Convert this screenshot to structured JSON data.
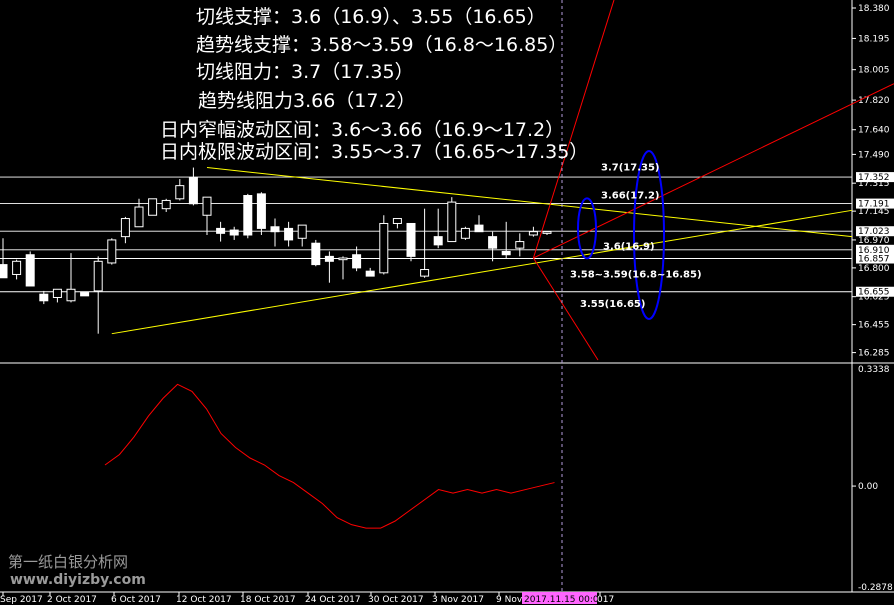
{
  "annotations": [
    "切线支撑：3.6（16.9）、3.55（16.65）",
    "趋势线支撑：3.58～3.59（16.8～16.85）",
    "切线阻力：3.7（17.35）",
    "趋势线阻力3.66（17.2）",
    "日内窄幅波动区间：3.6～3.66（16.9～17.2）",
    "日内极限波动区间：3.55～3.7（16.65～17.35）"
  ],
  "watermark": {
    "line1": "第一纸白银分析网",
    "line2": "www.diyizby.com"
  },
  "chart_data": {
    "type": "candlestick",
    "colors": {
      "background": "#000000",
      "axis": "#ffffff",
      "candle": "#ffffff",
      "macd_signal": "#ff0000",
      "trendline": "#ffff00",
      "resistance_fan": "#ff0000",
      "ellipse": "#0000ff",
      "cursor": "#b39ddb",
      "cursor_label_bg": "#ff66ff"
    },
    "price_axis": {
      "range": [
        16.24,
        18.38
      ],
      "ticks": [
        "18.380",
        "18.195",
        "18.005",
        "17.820",
        "17.640",
        "17.490",
        "17.315",
        "17.145",
        "16.970",
        "16.800",
        "16.625",
        "16.455",
        "16.285"
      ],
      "highlighted": [
        "17.352",
        "17.191",
        "17.023",
        "16.910",
        "16.857",
        "16.655"
      ]
    },
    "indicator_axis": {
      "range": [
        -0.2878,
        0.3338
      ],
      "ticks": [
        "0.3338",
        "0.00",
        "-0.2878"
      ]
    },
    "time_labels": [
      "Sep 2017",
      "2 Oct 2017",
      "6 Oct 2017",
      "12 Oct 2017",
      "18 Oct 2017",
      "24 Oct 2017",
      "30 Oct 2017",
      "3 Nov 2017",
      "9 Nov",
      "2017.11.15 00:00",
      "017"
    ],
    "horizontal_levels": [
      17.352,
      17.191,
      17.023,
      16.91,
      16.857,
      16.655
    ],
    "level_labels": [
      {
        "text": "3.7(17.35)",
        "value": 17.41
      },
      {
        "text": "3.66(17.2)",
        "value": 17.24
      },
      {
        "text": "3.6(16.9)",
        "value": 16.93
      },
      {
        "text": "3.58~3.59(16.8~16.85)",
        "value": 16.76
      },
      {
        "text": "3.55(16.65)",
        "value": 16.58
      }
    ],
    "candles": [
      {
        "o": 16.82,
        "h": 16.98,
        "l": 16.76,
        "c": 16.74
      },
      {
        "o": 16.76,
        "h": 16.85,
        "l": 16.73,
        "c": 16.84
      },
      {
        "o": 16.88,
        "h": 16.9,
        "l": 16.73,
        "c": 16.69
      },
      {
        "o": 16.64,
        "h": 16.66,
        "l": 16.58,
        "c": 16.6
      },
      {
        "o": 16.62,
        "h": 16.66,
        "l": 16.59,
        "c": 16.67
      },
      {
        "o": 16.6,
        "h": 16.89,
        "l": 16.59,
        "c": 16.67
      },
      {
        "o": 16.65,
        "h": 16.65,
        "l": 16.63,
        "c": 16.63
      },
      {
        "o": 16.66,
        "h": 16.87,
        "l": 16.4,
        "c": 16.84
      },
      {
        "o": 16.83,
        "h": 16.98,
        "l": 16.82,
        "c": 16.97
      },
      {
        "o": 16.99,
        "h": 17.11,
        "l": 16.95,
        "c": 17.1
      },
      {
        "o": 17.05,
        "h": 17.22,
        "l": 17.05,
        "c": 17.17
      },
      {
        "o": 17.12,
        "h": 17.22,
        "l": 17.12,
        "c": 17.22
      },
      {
        "o": 17.16,
        "h": 17.22,
        "l": 17.14,
        "c": 17.21
      },
      {
        "o": 17.22,
        "h": 17.34,
        "l": 17.21,
        "c": 17.3
      },
      {
        "o": 17.35,
        "h": 17.41,
        "l": 17.18,
        "c": 17.19
      },
      {
        "o": 17.12,
        "h": 17.18,
        "l": 17.0,
        "c": 17.23
      },
      {
        "o": 17.04,
        "h": 17.08,
        "l": 16.96,
        "c": 17.01
      },
      {
        "o": 17.03,
        "h": 17.05,
        "l": 16.97,
        "c": 17.0
      },
      {
        "o": 17.24,
        "h": 17.25,
        "l": 16.98,
        "c": 17.0
      },
      {
        "o": 17.25,
        "h": 17.26,
        "l": 17.0,
        "c": 17.04
      },
      {
        "o": 17.05,
        "h": 17.1,
        "l": 16.93,
        "c": 17.02
      },
      {
        "o": 17.04,
        "h": 17.08,
        "l": 16.93,
        "c": 16.97
      },
      {
        "o": 16.98,
        "h": 17.06,
        "l": 16.93,
        "c": 17.06
      },
      {
        "o": 16.95,
        "h": 16.97,
        "l": 16.81,
        "c": 16.82
      },
      {
        "o": 16.87,
        "h": 16.9,
        "l": 16.71,
        "c": 16.84
      },
      {
        "o": 16.85,
        "h": 16.87,
        "l": 16.73,
        "c": 16.86
      },
      {
        "o": 16.88,
        "h": 16.93,
        "l": 16.78,
        "c": 16.8
      },
      {
        "o": 16.78,
        "h": 16.8,
        "l": 16.75,
        "c": 16.75
      },
      {
        "o": 16.77,
        "h": 17.12,
        "l": 16.76,
        "c": 17.07
      },
      {
        "o": 17.07,
        "h": 17.1,
        "l": 17.04,
        "c": 17.1
      },
      {
        "o": 17.07,
        "h": 17.07,
        "l": 16.84,
        "c": 16.87
      },
      {
        "o": 16.75,
        "h": 17.16,
        "l": 16.74,
        "c": 16.79
      },
      {
        "o": 16.99,
        "h": 17.16,
        "l": 16.92,
        "c": 16.94
      },
      {
        "o": 16.96,
        "h": 17.23,
        "l": 16.96,
        "c": 17.2
      },
      {
        "o": 16.98,
        "h": 17.05,
        "l": 16.97,
        "c": 17.04
      },
      {
        "o": 17.06,
        "h": 17.12,
        "l": 17.03,
        "c": 17.02
      },
      {
        "o": 16.99,
        "h": 17.02,
        "l": 16.84,
        "c": 16.92
      },
      {
        "o": 16.9,
        "h": 17.08,
        "l": 16.86,
        "c": 16.88
      },
      {
        "o": 16.92,
        "h": 17.01,
        "l": 16.87,
        "c": 16.96
      },
      {
        "o": 17.0,
        "h": 17.05,
        "l": 16.99,
        "c": 17.02
      },
      {
        "o": 17.01,
        "h": 17.02,
        "l": 17.0,
        "c": 17.02
      }
    ],
    "signal_line": [
      0.06,
      0.09,
      0.14,
      0.2,
      0.25,
      0.29,
      0.27,
      0.22,
      0.15,
      0.11,
      0.08,
      0.06,
      0.03,
      0.01,
      -0.02,
      -0.05,
      -0.09,
      -0.11,
      -0.12,
      -0.12,
      -0.1,
      -0.07,
      -0.04,
      -0.01,
      -0.02,
      -0.01,
      -0.02,
      -0.01,
      -0.02,
      -0.01,
      0.0,
      0.01
    ],
    "histogram": [
      0.0,
      0.0,
      0.0,
      0.0,
      0.0,
      0.0,
      0.0,
      0.0,
      0.0,
      0.0,
      0.0,
      0.0,
      0.0,
      0.0,
      0.0,
      0.0,
      0.0,
      0.0,
      0.0,
      0.0,
      0.0,
      0.0,
      0.0,
      0.0,
      0.0,
      0.0,
      0.0,
      0.0,
      0.0,
      0.0,
      0.0,
      0.0,
      0.0,
      0.0,
      0.0,
      0.0,
      0.0,
      0.0,
      0.0,
      0.0,
      0.0,
      0.0,
      0.0,
      0.0,
      0.0,
      0.0,
      0.0,
      0.0,
      0.0,
      0.0,
      0.0,
      0.0,
      0.0,
      0.0,
      0.0,
      0.0,
      0.0,
      0.0,
      0.0,
      0.0
    ]
  }
}
